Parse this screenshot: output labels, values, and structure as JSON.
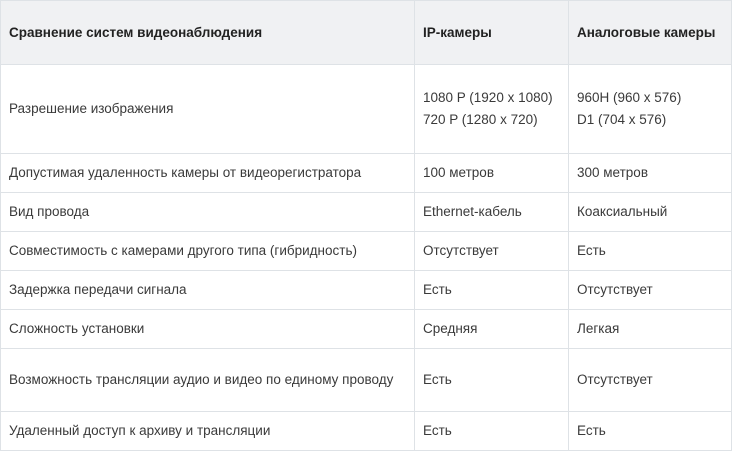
{
  "table": {
    "headers": [
      "Сравнение систем видеонаблюдения",
      "IP-камеры",
      "Аналоговые камеры"
    ],
    "rows": [
      {
        "feature": "Разрешение изображения",
        "ip": [
          "1080 P (1920 x 1080)",
          "720 P (1280 x 720)"
        ],
        "analog": [
          "960H (960 x 576)",
          "D1 (704 x 576)"
        ]
      },
      {
        "feature": "Допустимая удаленность камеры от видеорегистратора",
        "ip": "100 метров",
        "analog": "300 метров"
      },
      {
        "feature": "Вид провода",
        "ip": "Ethernet-кабель",
        "analog": "Коаксиальный"
      },
      {
        "feature": "Совместимость с камерами другого типа (гибридность)",
        "ip": "Отсутствует",
        "analog": "Есть"
      },
      {
        "feature": "Задержка передачи сигнала",
        "ip": "Есть",
        "analog": "Отсутствует"
      },
      {
        "feature": "Сложность установки",
        "ip": "Средняя",
        "analog": "Легкая"
      },
      {
        "feature": "Возможность трансляции аудио и видео по единому проводу",
        "ip": "Есть",
        "analog": "Отсутствует"
      },
      {
        "feature": "Удаленный доступ к архиву и трансляции",
        "ip": "Есть",
        "analog": "Есть"
      }
    ]
  }
}
